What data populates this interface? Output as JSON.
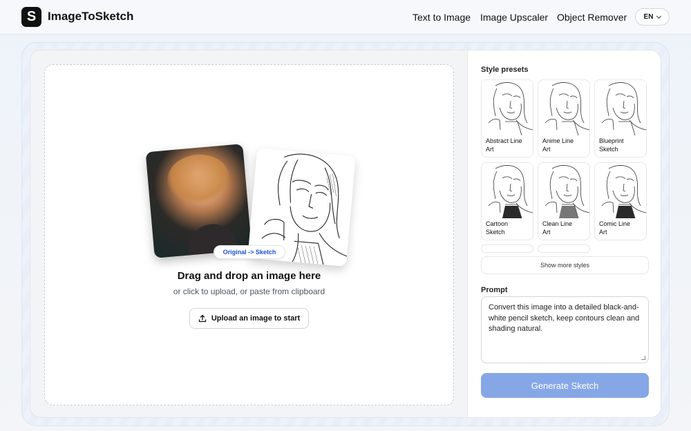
{
  "header": {
    "logo_glyph": "S",
    "brand": "ImageToSketch",
    "nav": [
      "Text to Image",
      "Image Upscaler",
      "Object Remover"
    ],
    "language": "EN"
  },
  "dropzone": {
    "badge": "Original -> Sketch",
    "title": "Drag and drop an image here",
    "subtitle": "or click to upload, or paste from clipboard",
    "upload_label": "Upload an image to start",
    "upload_icon": "upload-icon"
  },
  "presets": {
    "label": "Style presets",
    "items": [
      {
        "line1": "Abstract Line",
        "line2": "Art"
      },
      {
        "line1": "Anime Line",
        "line2": "Art"
      },
      {
        "line1": "Blueprint",
        "line2": "Sketch"
      },
      {
        "line1": "Cartoon",
        "line2": "Sketch"
      },
      {
        "line1": "Clean Line",
        "line2": "Art"
      },
      {
        "line1": "Comic Line",
        "line2": "Art"
      }
    ],
    "show_more": "Show more styles"
  },
  "prompt": {
    "label": "Prompt",
    "value": "Convert this image into a detailed black-and-white pencil sketch, keep contours clean and shading natural."
  },
  "generate_label": "Generate Sketch",
  "colors": {
    "accent": "#86a7e6",
    "badge_text": "#1d4ed8"
  }
}
